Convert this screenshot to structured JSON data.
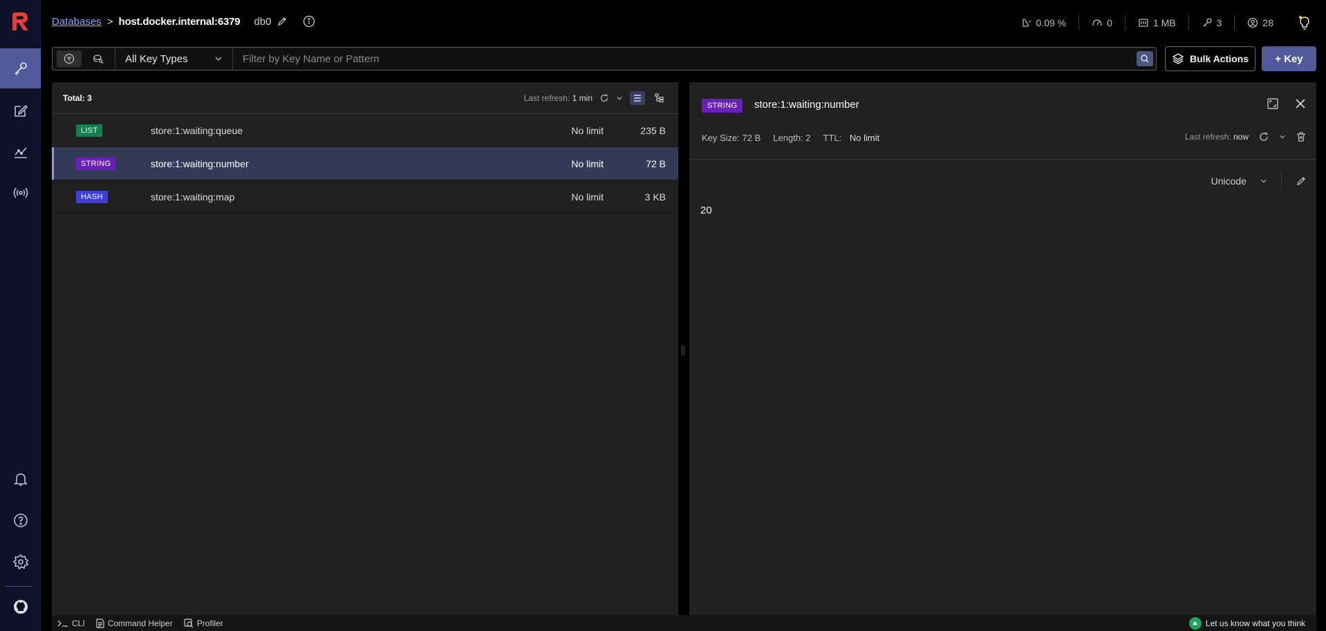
{
  "breadcrumb": {
    "databases_link": "Databases",
    "separator": ">",
    "host": "host.docker.internal:6379",
    "db": "db0"
  },
  "stats": {
    "cpu": "0.09 %",
    "ops": "0",
    "memory": "1 MB",
    "keys": "3",
    "clients": "28"
  },
  "filter": {
    "key_type": "All Key Types",
    "search_placeholder": "Filter by Key Name or Pattern",
    "bulk_actions": "Bulk Actions",
    "add_key": "+ Key"
  },
  "keylist": {
    "total": "Total: 3",
    "last_refresh_label": "Last refresh:",
    "last_refresh_value": "1 min",
    "rows": [
      {
        "type": "LIST",
        "type_color": "#10814b",
        "name": "store:1:waiting:queue",
        "ttl": "No limit",
        "size": "235 B"
      },
      {
        "type": "STRING",
        "type_color": "#6a1fb8",
        "name": "store:1:waiting:number",
        "ttl": "No limit",
        "size": "72 B"
      },
      {
        "type": "HASH",
        "type_color": "#3f3fdc",
        "name": "store:1:waiting:map",
        "ttl": "No limit",
        "size": "3 KB"
      }
    ]
  },
  "detail": {
    "type": "STRING",
    "key_name": "store:1:waiting:number",
    "key_size": "Key Size: 72 B",
    "length": "Length: 2",
    "ttl_label": "TTL:",
    "ttl_value": "No limit",
    "last_refresh_label": "Last refresh:",
    "last_refresh_value": "now",
    "format": "Unicode",
    "value": "20"
  },
  "bottombar": {
    "cli": "CLI",
    "command_helper": "Command Helper",
    "profiler": "Profiler",
    "feedback": "Let us know what you think"
  },
  "colors": {
    "accent": "#505a9a",
    "link": "#8da3ff",
    "sidebar_bg": "#101028",
    "logo": "#e53e3e"
  },
  "icons": {
    "sidebar_top": [
      "key-icon",
      "edit-icon",
      "analytics-icon",
      "pubsub-icon"
    ],
    "sidebar_bottom": [
      "bell-icon",
      "help-icon",
      "settings-icon",
      "github-icon"
    ]
  }
}
